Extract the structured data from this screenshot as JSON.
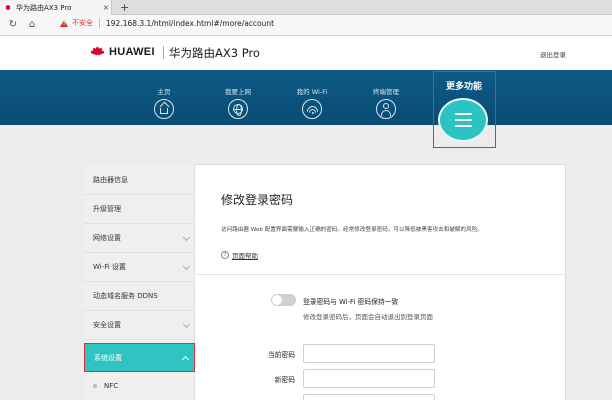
{
  "browser": {
    "tab_title": "华为路由AX3 Pro",
    "tab_close": "×",
    "new_tab": "+",
    "insecure_label": "不安全",
    "url": "192.168.3.1/html/index.html#/more/account",
    "icons": [
      "huawei-favicon",
      "close-icon",
      "plus-icon",
      "reload-icon",
      "home-icon",
      "warning-icon"
    ]
  },
  "header": {
    "brand": "HUAWEI",
    "product": "华为路由AX3 Pro",
    "logout": "退出登录",
    "brand_color": "#cf0a2c"
  },
  "nav": {
    "items": [
      {
        "label": "主页",
        "icon": "home-icon"
      },
      {
        "label": "我要上网",
        "icon": "globe-icon"
      },
      {
        "label": "我的 Wi-Fi",
        "icon": "wifi-icon"
      },
      {
        "label": "终端管理",
        "icon": "user-icon"
      }
    ],
    "more": {
      "label": "更多功能",
      "icon": "menu-icon"
    },
    "band_color": "#0b5580",
    "accent_color": "#2bc4c2",
    "highlight_color": "#e0303a"
  },
  "sidebar": {
    "items": [
      {
        "label": "路由器信息"
      },
      {
        "label": "升级管理"
      },
      {
        "label": "网络设置"
      },
      {
        "label": "Wi-Fi 设置"
      },
      {
        "label": "动态域名服务 DDNS"
      },
      {
        "label": "安全设置"
      },
      {
        "label": "系统设置"
      }
    ],
    "active_index": 6,
    "sub_items": [
      {
        "label": "NFC"
      }
    ]
  },
  "content": {
    "title": "修改登录密码",
    "description": "访问路由器 Web 配置界面需要输入正确的密码。经常修改登录密码，可以降低被黑客攻击和破解的风险。",
    "help_icon": "?",
    "help_link": "页面帮助",
    "sync_label": "登录密码与 Wi-Fi 密码保持一致",
    "sync_enabled": false,
    "sync_hint": "修改登录密码后，页面会自动退出到登录页面",
    "fields": [
      {
        "label": "当前密码",
        "value": ""
      },
      {
        "label": "新密码",
        "value": ""
      }
    ]
  }
}
